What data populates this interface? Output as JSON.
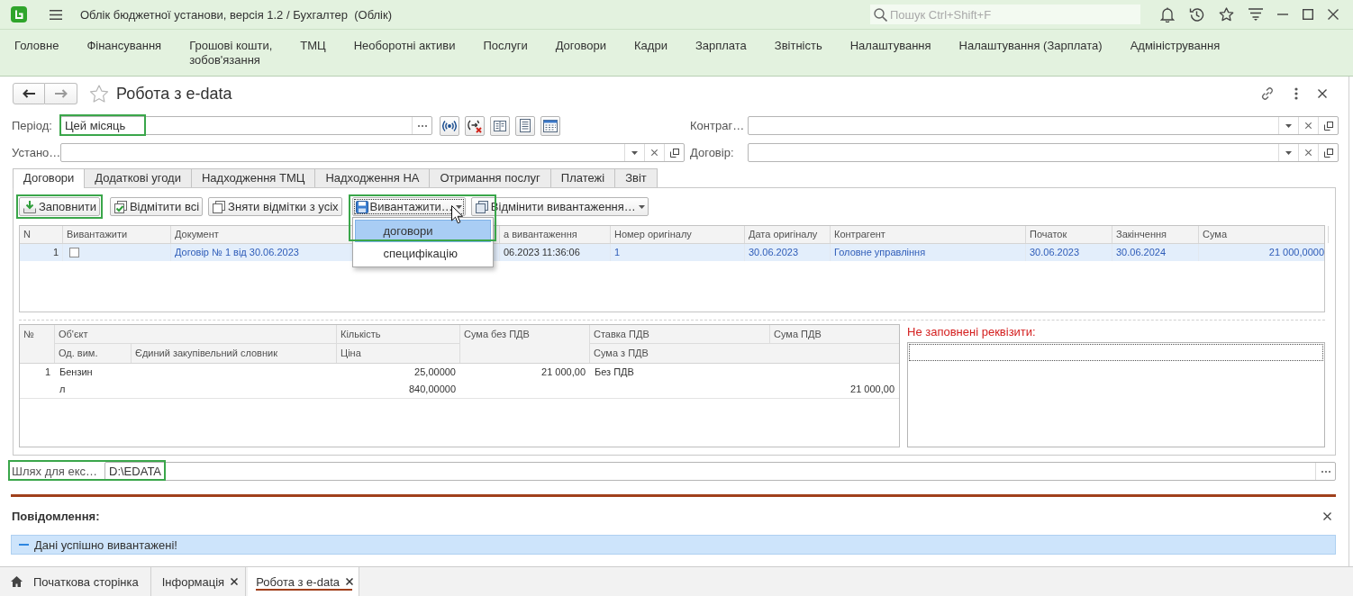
{
  "app": {
    "title": "Облік бюджетної установи, версія 1.2 / Бухгалтер  (Облік)",
    "search": {
      "placeholder": "Пошук Ctrl+Shift+F"
    }
  },
  "sections": [
    "Головне",
    "Фінансування",
    "Грошові кошти,\nзобов'язання",
    "ТМЦ",
    "Необоротні активи",
    "Послуги",
    "Договори",
    "Кадри",
    "Зарплата",
    "Звітність",
    "Налаштування",
    "Налаштування (Зарплата)",
    "Адміністрування"
  ],
  "form": {
    "title": "Робота з e-data"
  },
  "filters": {
    "period": {
      "label": "Період:",
      "value": "Цей місяць",
      "highlighted": true
    },
    "counterparty": {
      "label": "Контраг…"
    },
    "institution": {
      "label": "Устано…"
    },
    "contract": {
      "label": "Договір:"
    }
  },
  "tabs": [
    {
      "label": "Договори",
      "selected": true
    },
    {
      "label": "Додаткові угоди",
      "selected": false
    },
    {
      "label": "Надходження ТМЦ",
      "selected": false
    },
    {
      "label": "Надходження НА",
      "selected": false
    },
    {
      "label": "Отримання послуг",
      "selected": false
    },
    {
      "label": "Платежі",
      "selected": false
    },
    {
      "label": "Звіт",
      "selected": false
    }
  ],
  "toolbar": {
    "groups": [
      {
        "buttons": [
          {
            "label": "Заповнити",
            "kind": "fill",
            "dropdown": false,
            "focused": false,
            "hovered": false,
            "highlighted": true
          }
        ]
      },
      {
        "buttons": [
          {
            "label": "Відмітити всі",
            "kind": "check_all",
            "dropdown": false,
            "focused": false,
            "hovered": false,
            "highlighted": false
          },
          {
            "label": "Зняти відмітки з усіх",
            "kind": "uncheck_all",
            "dropdown": false,
            "focused": false,
            "hovered": false,
            "highlighted": false
          }
        ]
      },
      {
        "buttons": [
          {
            "label": "Вивантажити…",
            "kind": "export",
            "dropdown": true,
            "focused": true,
            "hovered": true,
            "highlighted": true
          },
          {
            "label": "Відмінити вивантаження…",
            "kind": "cancel_export",
            "dropdown": true,
            "focused": false,
            "hovered": false,
            "highlighted": false
          }
        ]
      }
    ]
  },
  "export_menu": {
    "items": [
      {
        "label": "договори",
        "selected": true
      },
      {
        "label": "специфікацію",
        "selected": false
      }
    ]
  },
  "contracts_table": {
    "columns": [
      "N",
      "Вивантажити",
      "Документ",
      "а вивантаження",
      "Номер оригіналу",
      "Дата оригіналу",
      "Контрагент",
      "Початок",
      "Закінчення",
      "Сума"
    ],
    "rows": [
      {
        "selected": true,
        "cells": [
          {
            "kind": "number",
            "text": "1"
          },
          {
            "kind": "checkbox",
            "checked": false
          },
          {
            "kind": "link",
            "text": "Договір № 1 від 30.06.2023"
          },
          {
            "kind": "text",
            "text": "06.2023 11:36:06"
          },
          {
            "kind": "link",
            "text": "1"
          },
          {
            "kind": "link",
            "text": "30.06.2023"
          },
          {
            "kind": "link",
            "text": "Головне управління"
          },
          {
            "kind": "link",
            "text": "30.06.2023"
          },
          {
            "kind": "link",
            "text": "30.06.2024"
          },
          {
            "kind": "amount",
            "text": "21 000,0000"
          }
        ]
      }
    ]
  },
  "items_table": {
    "header_top": [
      "№",
      "Об'єкт",
      "Кількість",
      "Сума без ПДВ",
      "Ставка ПДВ",
      "Сума ПДВ"
    ],
    "header_bottom": [
      "Од. вим.",
      "Єдиний закупівельний словник",
      "Ціна",
      "Сума з ПДВ"
    ],
    "rows": [
      {
        "n": "1",
        "object": "Бензин",
        "quantity": "25,00000",
        "sum_without_vat": "21 000,00",
        "vat_rate": "Без ПДВ",
        "unit": "л",
        "price": "840,00000",
        "sum_with_vat": "21 000,00"
      }
    ]
  },
  "missing_details": {
    "title": "Не заповнені реквізити:"
  },
  "export_path": {
    "label": "Шлях для екс…",
    "value": "D:\\EDATA",
    "highlighted": true
  },
  "messages": {
    "title": "Повідомлення:",
    "items": [
      "Дані успішно вивантажені!"
    ]
  },
  "open_windows": [
    {
      "label": "Початкова сторінка",
      "kind": "home",
      "selected": false
    },
    {
      "label": "Інформація",
      "kind": "page",
      "selected": false
    },
    {
      "label": "Робота з e-data",
      "kind": "page",
      "selected": true
    }
  ]
}
